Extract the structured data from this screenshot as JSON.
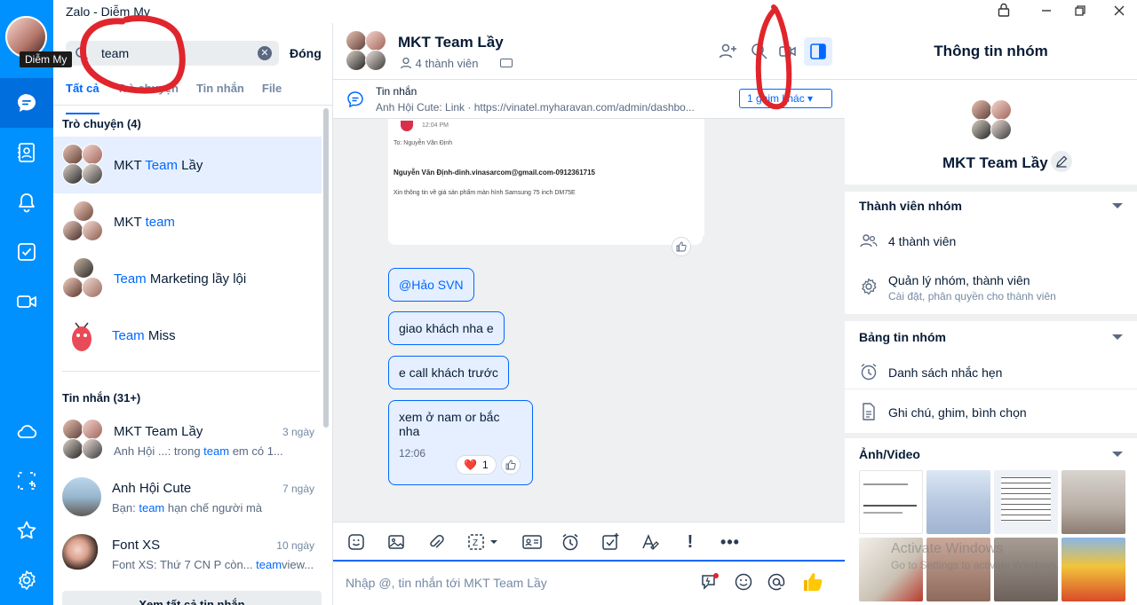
{
  "window": {
    "title": "Zalo - Diễm My",
    "controls": [
      "lock",
      "minimize",
      "maximize",
      "close"
    ]
  },
  "rail": {
    "user_tooltip": "Diễm My",
    "items": [
      "chat-icon",
      "contacts-icon",
      "bell-icon",
      "todo-icon",
      "video-icon",
      "cloud-icon",
      "screenshot-icon",
      "star-icon",
      "settings-icon"
    ]
  },
  "sidebar": {
    "search_value": "team",
    "close_label": "Đóng",
    "tabs": [
      {
        "label": "Tất cả",
        "active": true
      },
      {
        "label": "Trò chuyện",
        "active": false
      },
      {
        "label": "Tin nhắn",
        "active": false
      },
      {
        "label": "File",
        "active": false
      }
    ],
    "conversations_title": "Trò chuyện (4)",
    "conversations": [
      {
        "pre": "MKT ",
        "hl": "Team",
        "post": " Lầy"
      },
      {
        "pre": "MKT ",
        "hl": "team",
        "post": ""
      },
      {
        "pre": "",
        "hl": "Team",
        "post": " Marketing lầy lội"
      },
      {
        "pre": "",
        "hl": "Team",
        "post": " Miss"
      }
    ],
    "messages_title": "Tin nhắn (31+)",
    "messages": [
      {
        "name": "MKT Team Lầy",
        "time": "3 ngày",
        "sub_pre": "Anh Hội ...: trong ",
        "sub_hl": "team",
        "sub_post": " em có 1..."
      },
      {
        "name": "Anh Hội Cute",
        "time": "7 ngày",
        "sub_pre": "Bạn: ",
        "sub_hl": "team",
        "sub_post": " hạn chế người mà"
      },
      {
        "name": "Font XS",
        "time": "10 ngày",
        "sub_pre": "Font XS: Thứ 7 CN P còn... ",
        "sub_hl": "team",
        "sub_post": "view..."
      }
    ],
    "see_all_label": "Xem tất cả tin nhắn"
  },
  "chat": {
    "title": "MKT Team Lầy",
    "members": "4 thành viên",
    "pinned_label": "Tin nhắn",
    "pinned_text": "Anh Hội Cute:  Link · https://vinatel.myharavan.com/admin/dashbo...",
    "pinned_more": "1 ghim khác",
    "email_time": "12:04 PM",
    "email_to": "To: Nguyễn Văn Định",
    "email_sender": "Nguyễn Văn Định-dinh.vinasarcom@gmail.com-0912361715",
    "email_body": "Xin thông tin về giá sản phẩm màn hình Samsung 75 inch DM75E",
    "messages": [
      {
        "text": "@Hảo SVN",
        "mention": true
      },
      {
        "text": "giao khách nha e"
      },
      {
        "text": "e call khách trước"
      },
      {
        "text": "xem ở nam or bắc nha",
        "time": "12:06",
        "reaction_count": "1"
      }
    ],
    "input_placeholder": "Nhập @, tin nhắn tới MKT Team Lầy"
  },
  "info": {
    "title": "Thông tin nhóm",
    "group_name": "MKT Team Lầy",
    "members_section": "Thành viên nhóm",
    "member_count": "4 thành viên",
    "manage_label": "Quản lý nhóm, thành viên",
    "manage_sub": "Cài đặt, phân quyền cho thành viên",
    "board_section": "Bảng tin nhóm",
    "reminders": "Danh sách nhắc hẹn",
    "notes": "Ghi chú, ghim, bình chọn",
    "media_section": "Ảnh/Video",
    "watermark_line1": "Activate Windows",
    "watermark_line2": "Go to Settings to activate Windows."
  },
  "colors": {
    "rail": "#0091ff",
    "accent": "#0068ff",
    "bubble": "#e5efff",
    "annotation": "#e0252c"
  }
}
